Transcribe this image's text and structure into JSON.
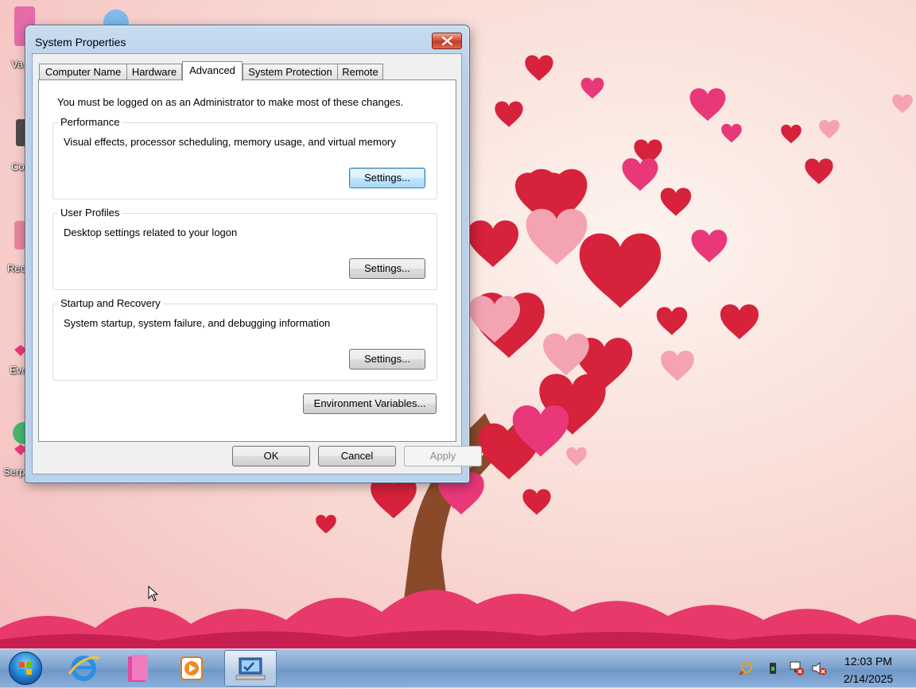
{
  "dialog": {
    "title": "System Properties",
    "tabs": [
      "Computer Name",
      "Hardware",
      "Advanced",
      "System Protection",
      "Remote"
    ],
    "active_tab": "Advanced",
    "admin_note": "You must be logged on as an Administrator to make most of these changes.",
    "groups": [
      {
        "title": "Performance",
        "description": "Visual effects, processor scheduling, memory usage, and virtual memory",
        "button": "Settings..."
      },
      {
        "title": "User Profiles",
        "description": "Desktop settings related to your logon",
        "button": "Settings..."
      },
      {
        "title": "Startup and Recovery",
        "description": "System startup, system failure, and debugging information",
        "button": "Settings..."
      }
    ],
    "env_button": "Environment Variables...",
    "ok": "OK",
    "cancel": "Cancel",
    "apply": "Apply"
  },
  "desktop": {
    "icon_labels": [
      "Va",
      "Co",
      "Rec",
      "Eve",
      "Serp"
    ]
  },
  "taskbar": {
    "items": [
      "start-orb",
      "internet-explorer-icon",
      "library-folder-icon",
      "media-player-icon",
      "system-properties-icon"
    ],
    "tray": [
      "action-center-icon",
      "usb-icon",
      "network-icon",
      "volume-muted-icon"
    ],
    "time": "12:03 PM",
    "date": "2/14/2025"
  }
}
